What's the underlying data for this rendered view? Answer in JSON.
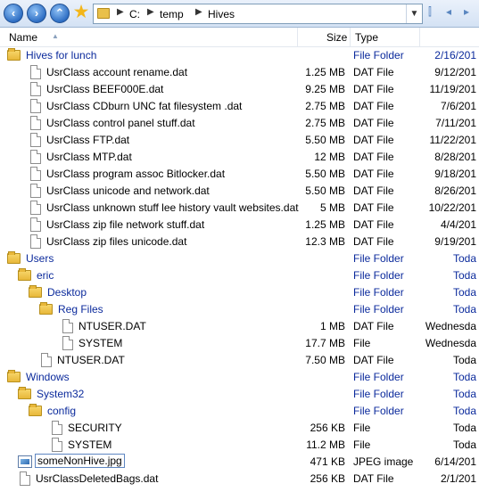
{
  "nav": {
    "back_icon": "back-arrow-icon",
    "forward_icon": "forward-arrow-icon",
    "up_icon": "up-arrow-icon",
    "favorites_icon": "star-icon",
    "path": [
      "C:",
      "temp",
      "Hives"
    ]
  },
  "columns": {
    "name": "Name",
    "size": "Size",
    "type": "Type"
  },
  "rows": [
    {
      "name": "Hives for lunch",
      "size": "",
      "type": "File Folder",
      "date": "2/16/201",
      "kind": "folder",
      "depth": 0,
      "expanded": true
    },
    {
      "name": "UsrClass account rename.dat",
      "size": "1.25 MB",
      "type": "DAT File",
      "date": "9/12/201",
      "kind": "file",
      "depth": 1
    },
    {
      "name": "UsrClass BEEF000E.dat",
      "size": "9.25 MB",
      "type": "DAT File",
      "date": "11/19/201",
      "kind": "file",
      "depth": 1
    },
    {
      "name": "UsrClass CDburn UNC fat filesystem .dat",
      "size": "2.75 MB",
      "type": "DAT File",
      "date": "7/6/201",
      "kind": "file",
      "depth": 1
    },
    {
      "name": "UsrClass control panel stuff.dat",
      "size": "2.75 MB",
      "type": "DAT File",
      "date": "7/11/201",
      "kind": "file",
      "depth": 1
    },
    {
      "name": "UsrClass FTP.dat",
      "size": "5.50 MB",
      "type": "DAT File",
      "date": "11/22/201",
      "kind": "file",
      "depth": 1
    },
    {
      "name": "UsrClass MTP.dat",
      "size": "12 MB",
      "type": "DAT File",
      "date": "8/28/201",
      "kind": "file",
      "depth": 1
    },
    {
      "name": "UsrClass program assoc Bitlocker.dat",
      "size": "5.50 MB",
      "type": "DAT File",
      "date": "9/18/201",
      "kind": "file",
      "depth": 1
    },
    {
      "name": "UsrClass unicode and network.dat",
      "size": "5.50 MB",
      "type": "DAT File",
      "date": "8/26/201",
      "kind": "file",
      "depth": 1
    },
    {
      "name": "UsrClass unknown stuff lee history vault websites.dat",
      "size": "5 MB",
      "type": "DAT File",
      "date": "10/22/201",
      "kind": "file",
      "depth": 1
    },
    {
      "name": "UsrClass zip file network stuff.dat",
      "size": "1.25 MB",
      "type": "DAT File",
      "date": "4/4/201",
      "kind": "file",
      "depth": 1
    },
    {
      "name": "UsrClass zip files unicode.dat",
      "size": "12.3 MB",
      "type": "DAT File",
      "date": "9/19/201",
      "kind": "file",
      "depth": 1
    },
    {
      "name": "Users",
      "size": "",
      "type": "File Folder",
      "date": "Toda",
      "kind": "folder",
      "depth": 0,
      "expanded": true
    },
    {
      "name": "eric",
      "size": "",
      "type": "File Folder",
      "date": "Toda",
      "kind": "folder",
      "depth": 1,
      "expanded": true
    },
    {
      "name": "Desktop",
      "size": "",
      "type": "File Folder",
      "date": "Toda",
      "kind": "folder",
      "depth": 2,
      "expanded": true
    },
    {
      "name": "Reg Files",
      "size": "",
      "type": "File Folder",
      "date": "Toda",
      "kind": "folder",
      "depth": 3,
      "expanded": true
    },
    {
      "name": "NTUSER.DAT",
      "size": "1 MB",
      "type": "DAT File",
      "date": "Wednesda",
      "kind": "file",
      "depth": 4
    },
    {
      "name": "SYSTEM",
      "size": "17.7 MB",
      "type": "File",
      "date": "Wednesda",
      "kind": "file",
      "depth": 4
    },
    {
      "name": "NTUSER.DAT",
      "size": "7.50 MB",
      "type": "DAT File",
      "date": "Toda",
      "kind": "file",
      "depth": 2
    },
    {
      "name": "Windows",
      "size": "",
      "type": "File Folder",
      "date": "Toda",
      "kind": "folder",
      "depth": 0,
      "expanded": true
    },
    {
      "name": "System32",
      "size": "",
      "type": "File Folder",
      "date": "Toda",
      "kind": "folder",
      "depth": 1,
      "expanded": true
    },
    {
      "name": "config",
      "size": "",
      "type": "File Folder",
      "date": "Toda",
      "kind": "folder",
      "depth": 2,
      "expanded": true
    },
    {
      "name": "SECURITY",
      "size": "256 KB",
      "type": "File",
      "date": "Toda",
      "kind": "file",
      "depth": 3
    },
    {
      "name": "SYSTEM",
      "size": "11.2 MB",
      "type": "File",
      "date": "Toda",
      "kind": "file",
      "depth": 3
    },
    {
      "name": "someNonHive.jpg",
      "size": "471 KB",
      "type": "JPEG image",
      "date": "6/14/201",
      "kind": "image",
      "depth": 0,
      "selected": true
    },
    {
      "name": "UsrClassDeletedBags.dat",
      "size": "256 KB",
      "type": "DAT File",
      "date": "2/1/201",
      "kind": "file",
      "depth": 0
    }
  ]
}
